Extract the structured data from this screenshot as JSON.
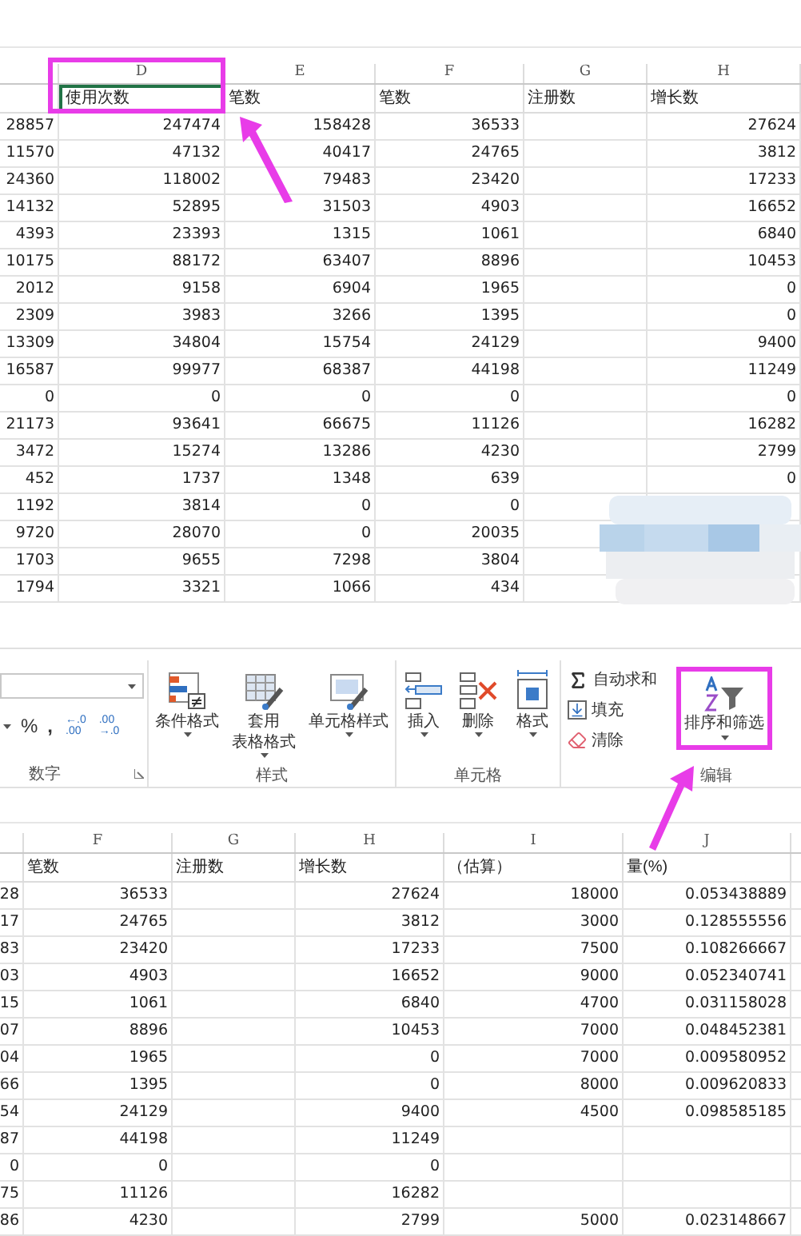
{
  "top_sheet": {
    "column_letters": [
      "D",
      "E",
      "F",
      "G",
      "H"
    ],
    "highlight_box": true,
    "headers": [
      {
        "text": "使用次数",
        "selected": true
      },
      {
        "text": "笔数",
        "selected": false
      },
      {
        "text": "笔数",
        "selected": false
      },
      {
        "text": "注册数",
        "selected": false
      },
      {
        "text": "增长数",
        "selected": false
      }
    ],
    "rows": [
      [
        "28857",
        "247474",
        "158428",
        "36533",
        null,
        "27624"
      ],
      [
        "11570",
        "47132",
        "40417",
        "24765",
        null,
        "3812"
      ],
      [
        "24360",
        "118002",
        "79483",
        "23420",
        null,
        "17233"
      ],
      [
        "14132",
        "52895",
        "31503",
        "4903",
        null,
        "16652"
      ],
      [
        "4393",
        "23393",
        "1315",
        "1061",
        null,
        "6840"
      ],
      [
        "10175",
        "88172",
        "63407",
        "8896",
        null,
        "10453"
      ],
      [
        "2012",
        "9158",
        "6904",
        "1965",
        null,
        "0"
      ],
      [
        "2309",
        "3983",
        "3266",
        "1395",
        null,
        "0"
      ],
      [
        "13309",
        "34804",
        "15754",
        "24129",
        null,
        "9400"
      ],
      [
        "16587",
        "99977",
        "68387",
        "44198",
        null,
        "11249"
      ],
      [
        "0",
        "0",
        "0",
        "0",
        null,
        "0"
      ],
      [
        "21173",
        "93641",
        "66675",
        "11126",
        null,
        "16282"
      ],
      [
        "3472",
        "15274",
        "13286",
        "4230",
        null,
        "2799"
      ],
      [
        "452",
        "1737",
        "1348",
        "639",
        null,
        "0"
      ],
      [
        "1192",
        "3814",
        "0",
        "0",
        null,
        null
      ],
      [
        "9720",
        "28070",
        "0",
        "20035",
        null,
        null
      ],
      [
        "1703",
        "9655",
        "7298",
        "3804",
        null,
        null
      ],
      [
        "1794",
        "3321",
        "1066",
        "434",
        null,
        null
      ]
    ]
  },
  "ribbon": {
    "number_group": {
      "label": "数字",
      "symbols": [
        "%",
        ","
      ],
      "decimal_buttons": [
        {
          "top": "←.0",
          "bottom": ".00"
        },
        {
          "top": ".00",
          "bottom": "→.0"
        }
      ]
    },
    "groups": [
      {
        "label": "样式",
        "buttons": [
          {
            "lines": [
              "条件格式"
            ]
          },
          {
            "lines": [
              "套用",
              "表格格式"
            ]
          },
          {
            "lines": [
              "单元格样式"
            ]
          }
        ]
      },
      {
        "label": "单元格",
        "buttons": [
          {
            "lines": [
              "插入"
            ]
          },
          {
            "lines": [
              "删除"
            ]
          },
          {
            "lines": [
              "格式"
            ]
          }
        ]
      }
    ],
    "editing": {
      "label": "编辑",
      "small_buttons": [
        {
          "label": "自动求和"
        },
        {
          "label": "填充"
        },
        {
          "label": "清除"
        }
      ],
      "sort_button": {
        "label": "排序和筛选",
        "highlighted": true
      }
    }
  },
  "bottom_sheet": {
    "column_letters": [
      "F",
      "G",
      "H",
      "I",
      "J"
    ],
    "headers": [
      {
        "text": "笔数",
        "selected": false
      },
      {
        "text": "注册数",
        "selected": false
      },
      {
        "text": "增长数",
        "selected": false
      },
      {
        "text": "（估算）",
        "selected": false
      },
      {
        "text": "量(%)",
        "selected": false
      }
    ],
    "rows": [
      [
        "28",
        "36533",
        null,
        "27624",
        "18000",
        "0.053438889"
      ],
      [
        "17",
        "24765",
        null,
        "3812",
        "3000",
        "0.128555556"
      ],
      [
        "83",
        "23420",
        null,
        "17233",
        "7500",
        "0.108266667"
      ],
      [
        "03",
        "4903",
        null,
        "16652",
        "9000",
        "0.052340741"
      ],
      [
        "15",
        "1061",
        null,
        "6840",
        "4700",
        "0.031158028"
      ],
      [
        "07",
        "8896",
        null,
        "10453",
        "7000",
        "0.048452381"
      ],
      [
        "04",
        "1965",
        null,
        "0",
        "7000",
        "0.009580952"
      ],
      [
        "66",
        "1395",
        null,
        "0",
        "8000",
        "0.009620833"
      ],
      [
        "54",
        "24129",
        null,
        "9400",
        "4500",
        "0.098585185"
      ],
      [
        "87",
        "44198",
        null,
        "11249",
        null,
        null
      ],
      [
        "0",
        "0",
        null,
        "0",
        null,
        null
      ],
      [
        "75",
        "11126",
        null,
        "16282",
        null,
        null
      ],
      [
        "86",
        "4230",
        null,
        "2799",
        "5000",
        "0.023148667"
      ]
    ]
  }
}
